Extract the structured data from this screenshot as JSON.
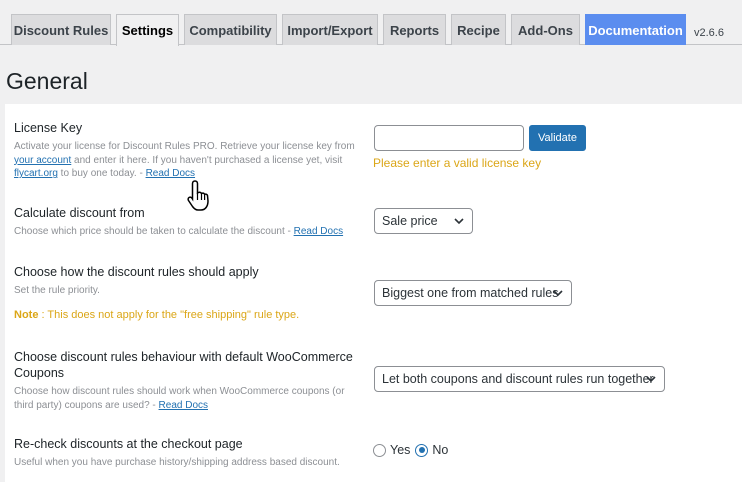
{
  "tabs": [
    {
      "label": "Discount Rules",
      "active": false
    },
    {
      "label": "Settings",
      "active": true
    },
    {
      "label": "Compatibility",
      "active": false
    },
    {
      "label": "Import/Export",
      "active": false
    },
    {
      "label": "Reports",
      "active": false
    },
    {
      "label": "Recipe",
      "active": false
    },
    {
      "label": "Add-Ons",
      "active": false
    },
    {
      "label": "Documentation",
      "active": false
    }
  ],
  "version": "v2.6.6",
  "page_title": "General",
  "license": {
    "label": "License Key",
    "desc_1": "Activate your license for Discount Rules PRO. Retrieve your license key from",
    "link_account": "your account",
    "desc_2": " and enter it here. If you haven't purchased a license yet, visit",
    "link_flycart": "flycart.org",
    "desc_3": " to buy one today. - ",
    "link_docs": "Read Docs",
    "input_value": "",
    "validate_label": "Validate",
    "warning": "Please enter a valid license key"
  },
  "calculate": {
    "label": "Calculate discount from",
    "desc": "Choose which price should be taken to calculate the discount - ",
    "link_docs": "Read Docs",
    "selected": "Sale price"
  },
  "apply": {
    "label": "Choose how the discount rules should apply",
    "desc": "Set the rule priority.",
    "note_prefix": "Note",
    "note_text": " : This does not apply for the \"free shipping\" rule type.",
    "selected": "Biggest one from matched rules"
  },
  "coupons": {
    "label": "Choose discount rules behaviour with default WooCommerce Coupons",
    "desc": "Choose how discount rules should work when WooCommerce coupons (or third party) coupons are used? - ",
    "link_docs": "Read Docs",
    "selected": "Let both coupons and discount rules run together"
  },
  "recheck": {
    "label": "Re-check discounts at the checkout page",
    "desc": "Useful when you have purchase history/shipping address based discount.",
    "yes_label": "Yes",
    "no_label": "No",
    "selected": "No"
  },
  "colors": {
    "accent": "#2271b1",
    "documentation_tab": "#5b8def",
    "warning": "#dba617"
  },
  "icons": [
    "chevron-down-icon",
    "hand-pointer-cursor-icon"
  ]
}
